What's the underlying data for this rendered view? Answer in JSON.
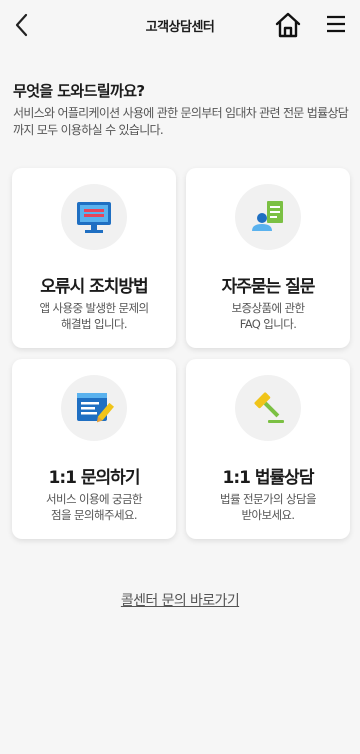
{
  "header": {
    "title": "고객상담센터",
    "back_icon": "chevron-left-icon",
    "home_icon": "home-icon",
    "menu_icon": "hamburger-menu-icon"
  },
  "intro": {
    "title": "무엇을 도와드릴까요?",
    "description": "서비스와 어플리케이션 사용에 관한 문의부터 임대차 관련 전문 법률상담까지 모두 이용하실 수 있습니다."
  },
  "cards": [
    {
      "title": "오류시 조치방법",
      "desc_line1": "앱 사용중 발생한 문제의",
      "desc_line2": "해결법 입니다.",
      "icon": "monitor-error-icon"
    },
    {
      "title": "자주묻는 질문",
      "desc_line1": "보증상품에 관한",
      "desc_line2": "FAQ 입니다.",
      "icon": "person-document-icon"
    },
    {
      "title": "1:1 문의하기",
      "desc_line1": "서비스 이용에 궁금한",
      "desc_line2": "점을 문의해주세요.",
      "icon": "document-pencil-icon"
    },
    {
      "title": "1:1 법률상담",
      "desc_line1": "법률 전문가의 상담을",
      "desc_line2": "받아보세요.",
      "icon": "gavel-icon"
    }
  ],
  "footer": {
    "callcenter_link": "콜센터 문의 바로가기"
  },
  "colors": {
    "background": "#f6f6f6",
    "icon_blue": "#1f6fc2",
    "icon_light_blue": "#5ab2ee",
    "icon_green": "#7bc043",
    "icon_yellow": "#f0c419"
  }
}
